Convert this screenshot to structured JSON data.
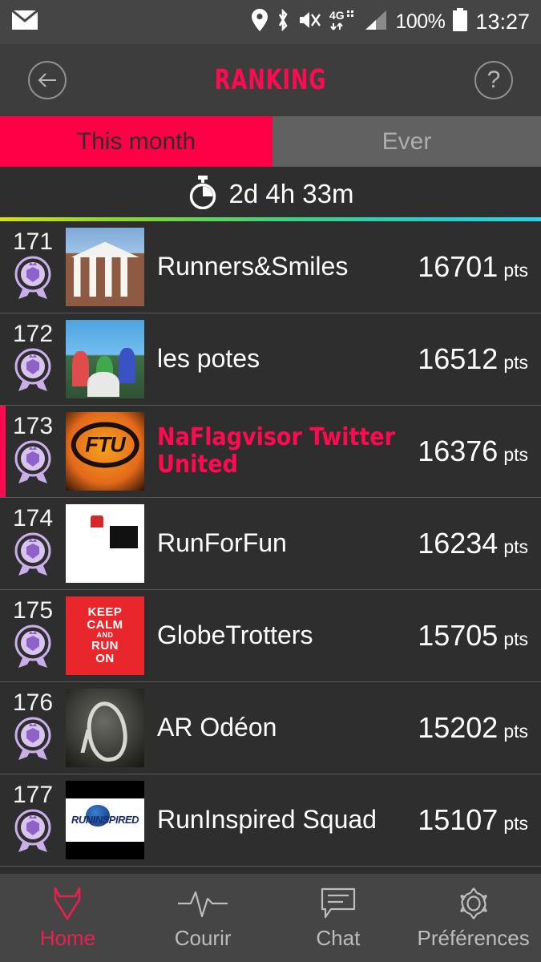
{
  "status_bar": {
    "mail_icon": "mail-icon",
    "location_icon": "location-pin-icon",
    "bluetooth_icon": "bluetooth-icon",
    "mute_icon": "volume-mute-icon",
    "network_type": "4G",
    "signal_icon": "signal-bars-icon",
    "battery_percent": "100%",
    "battery_icon": "battery-full-icon",
    "clock": "13:27"
  },
  "header": {
    "title": "RANKING",
    "back_icon": "back-arrow-icon",
    "help_icon": "help-question-icon",
    "accent_color": "#ff0a50"
  },
  "tabs": {
    "items": [
      {
        "label": "This month",
        "active": true
      },
      {
        "label": "Ever",
        "active": false
      }
    ],
    "active_bg": "#ff0046",
    "inactive_bg": "#616161"
  },
  "timer": {
    "icon": "stopwatch-icon",
    "remaining": "2d 4h 33m"
  },
  "ranking": {
    "rows": [
      {
        "rank": "171",
        "badge_icon": "award-rosette-icon",
        "thumb": "t-house",
        "team": "Runners&Smiles",
        "points": "16701",
        "unit": "pts",
        "highlighted": false
      },
      {
        "rank": "172",
        "badge_icon": "award-rosette-icon",
        "thumb": "t-group",
        "team": "les potes",
        "points": "16512",
        "unit": "pts",
        "highlighted": false
      },
      {
        "rank": "173",
        "badge_icon": "award-rosette-icon",
        "thumb": "t-ftu",
        "team": "NaFlagvisor Twitter United",
        "points": "16376",
        "unit": "pts",
        "highlighted": true
      },
      {
        "rank": "174",
        "badge_icon": "award-rosette-icon",
        "thumb": "t-rff",
        "team": "RunForFun",
        "points": "16234",
        "unit": "pts",
        "highlighted": false
      },
      {
        "rank": "175",
        "badge_icon": "award-rosette-icon",
        "thumb": "t-keep",
        "team": "GlobeTrotters",
        "points": "15705",
        "unit": "pts",
        "highlighted": false
      },
      {
        "rank": "176",
        "badge_icon": "award-rosette-icon",
        "thumb": "t-odeon",
        "team": "AR Odéon",
        "points": "15202",
        "unit": "pts",
        "highlighted": false
      },
      {
        "rank": "177",
        "badge_icon": "award-rosette-icon",
        "thumb": "t-rins",
        "team": "RunInspired Squad",
        "points": "15107",
        "unit": "pts",
        "highlighted": false
      }
    ],
    "thumb_text": {
      "ftu": "FTU",
      "keep_calm_l1": "KEEP",
      "keep_calm_l2": "CALM",
      "keep_calm_l3": "AND",
      "keep_calm_l4": "RUN",
      "keep_calm_l5": "ON",
      "runinspired": "RUNINSPIRED"
    },
    "highlight_color": "#ff0a50"
  },
  "bottom_nav": {
    "items": [
      {
        "label": "Home",
        "icon": "fox-head-icon",
        "active": true
      },
      {
        "label": "Courir",
        "icon": "heartbeat-pulse-icon",
        "active": false
      },
      {
        "label": "Chat",
        "icon": "speech-bubble-icon",
        "active": false
      },
      {
        "label": "Préférences",
        "icon": "gear-icon",
        "active": false
      }
    ],
    "active_color": "#e8204e"
  }
}
